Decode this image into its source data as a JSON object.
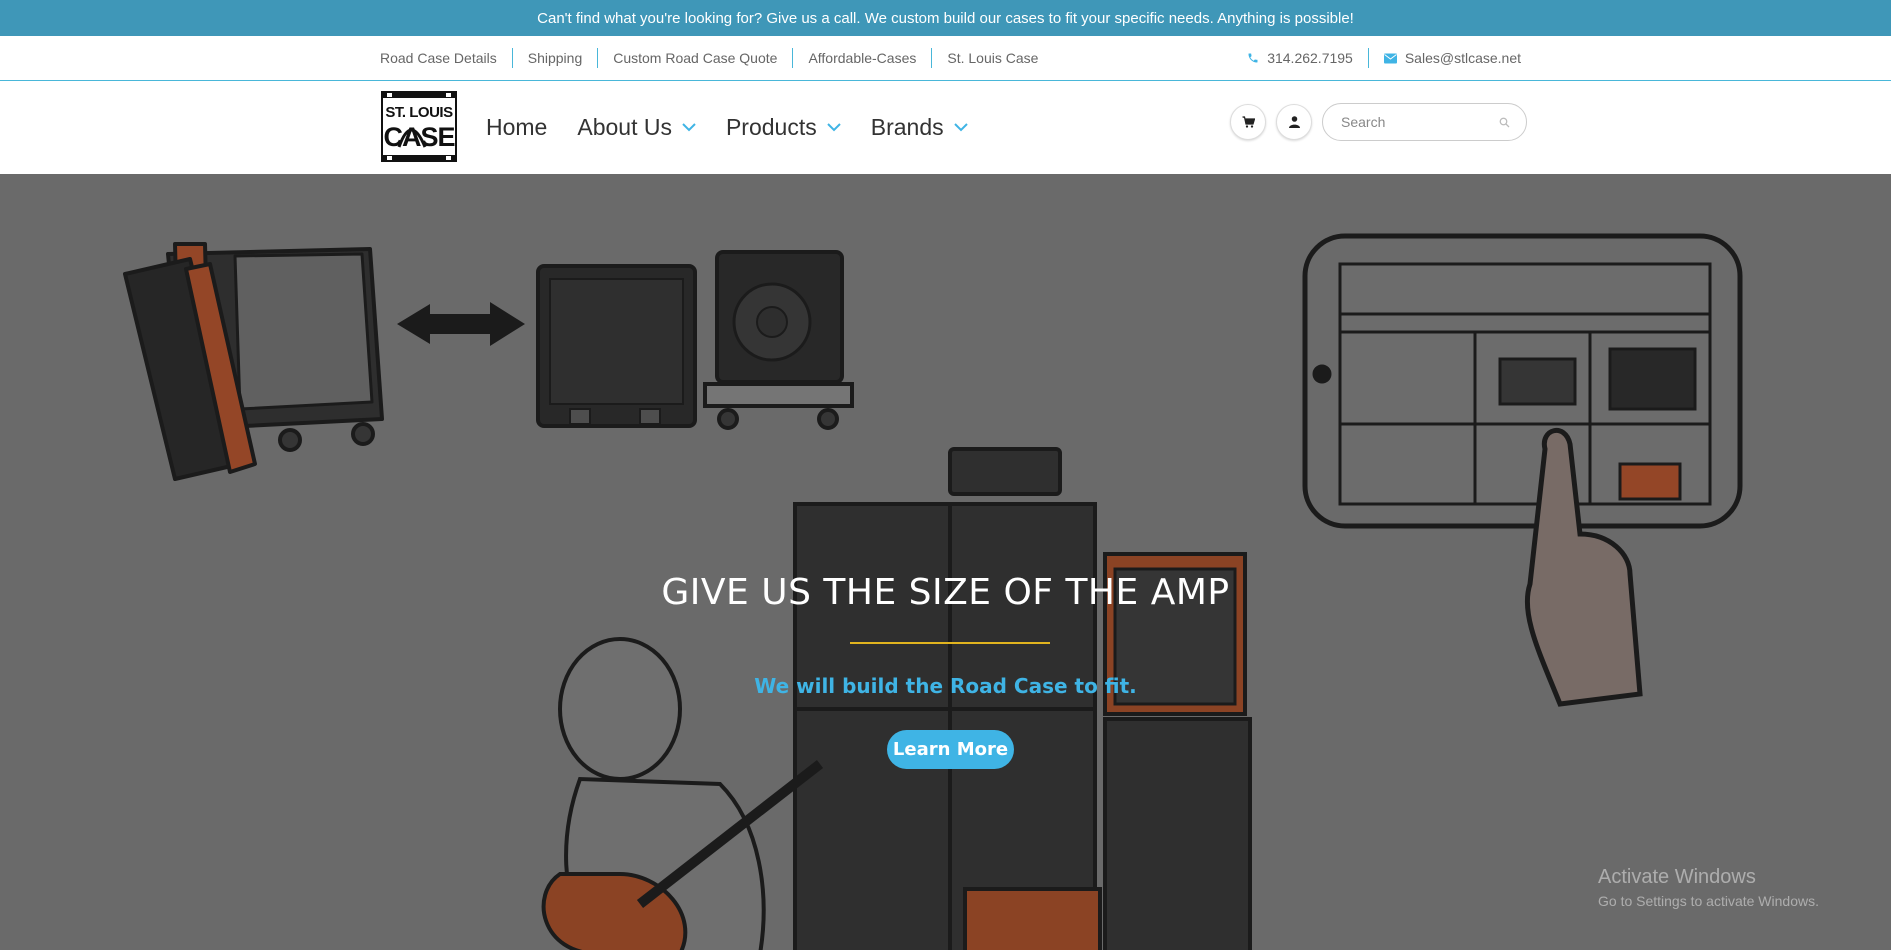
{
  "announcement": "Can't find what you're looking for?  Give us a call. We custom build our cases to fit your specific needs. Anything is possible!",
  "utility": {
    "links": [
      "Road Case Details",
      "Shipping",
      "Custom Road Case Quote",
      "Affordable-Cases",
      "St. Louis Case"
    ],
    "phone": "314.262.7195",
    "email": "Sales@stlcase.net"
  },
  "header": {
    "logo_text_top": "ST. LOUIS",
    "logo_text_bottom": "CASE",
    "nav": [
      {
        "label": "Home",
        "dropdown": false
      },
      {
        "label": "About Us",
        "dropdown": true
      },
      {
        "label": "Products",
        "dropdown": true
      },
      {
        "label": "Brands",
        "dropdown": true
      }
    ],
    "search_placeholder": "Search"
  },
  "hero": {
    "title": "GIVE US THE SIZE OF THE AMP",
    "subtitle": "We will build the Road Case to fit.",
    "button": "Learn More"
  },
  "windows_watermark": {
    "line1": "Activate Windows",
    "line2": "Go to Settings to activate Windows."
  },
  "colors": {
    "announce_bg": "#3f97b8",
    "accent": "#3fb4e5",
    "divider_gold": "#e1b41f",
    "hero_bg": "#7a7a7a"
  }
}
